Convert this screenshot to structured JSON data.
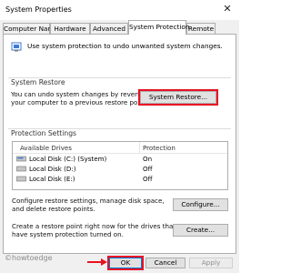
{
  "window": {
    "title": "System Properties",
    "close_glyph": "✕"
  },
  "tabs": [
    {
      "label": "Computer Name"
    },
    {
      "label": "Hardware"
    },
    {
      "label": "Advanced"
    },
    {
      "label": "System Protection"
    },
    {
      "label": "Remote"
    }
  ],
  "intro": {
    "text": "Use system protection to undo unwanted system changes.",
    "icon": "shield-icon"
  },
  "system_restore": {
    "title": "System Restore",
    "line1": "You can undo system changes by reverting",
    "line2": "your computer to a previous restore point.",
    "button": "System Restore..."
  },
  "protection": {
    "title": "Protection Settings",
    "col_drives": "Available Drives",
    "col_protection": "Protection",
    "rows": [
      {
        "name": "Local Disk (C:) (System)",
        "protection": "On"
      },
      {
        "name": "Local Disk (D:)",
        "protection": "Off"
      },
      {
        "name": "Local Disk (E:)",
        "protection": "Off"
      }
    ],
    "configure_line1": "Configure restore settings, manage disk space,",
    "configure_line2": "and delete restore points.",
    "configure_button": "Configure...",
    "create_line1": "Create a restore point right now for the drives that",
    "create_line2": "have system protection turned on.",
    "create_button": "Create..."
  },
  "footer": {
    "ok": "OK",
    "cancel": "Cancel",
    "apply": "Apply"
  },
  "watermark": "©howtoedge",
  "colors": {
    "highlight": "#e81123",
    "accent": "#0078d7"
  }
}
